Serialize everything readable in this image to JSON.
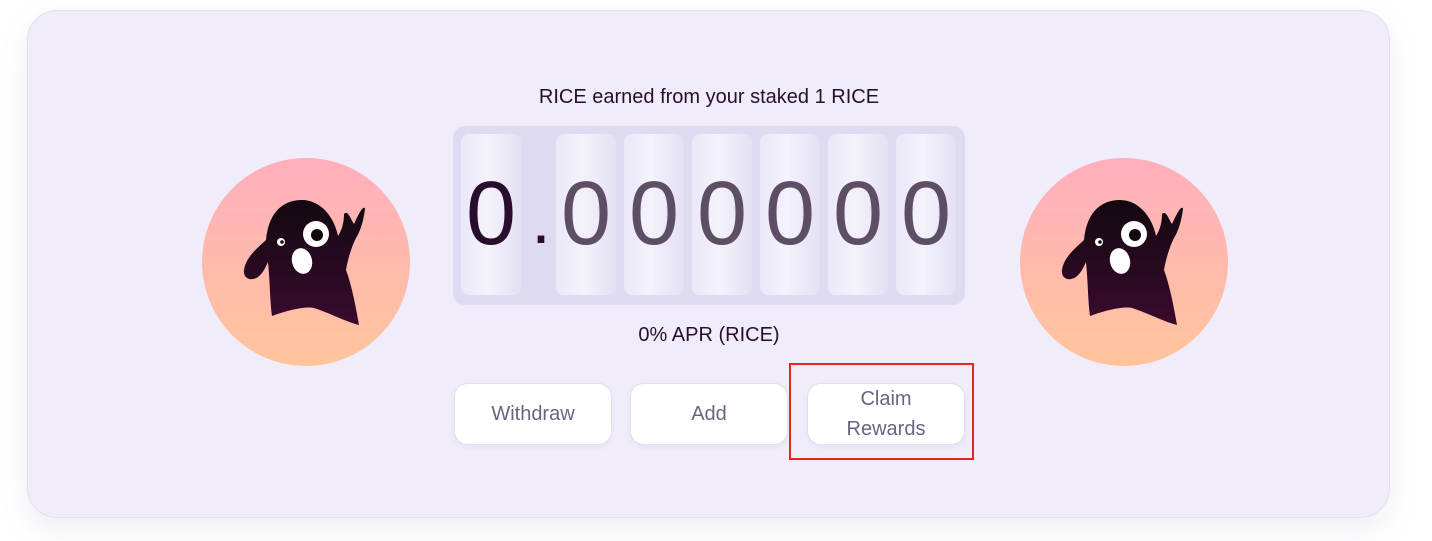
{
  "staking": {
    "earned_label": "RICE earned from your staked 1 RICE",
    "earned_value": "0.000000",
    "digits": {
      "whole": "0",
      "decimal_point": ".",
      "d1": "0",
      "d2": "0",
      "d3": "0",
      "d4": "0",
      "d5": "0",
      "d6": "0"
    },
    "apr_label": "0% APR (RICE)"
  },
  "actions": {
    "withdraw_label": "Withdraw",
    "add_label": "Add",
    "claim_label": "Claim Rewards"
  },
  "mascot": {
    "icon": "ghost-mascot-icon",
    "gradient_top": "#ffaebd",
    "gradient_bottom": "#ffc59d",
    "body_color": "#280d2f"
  },
  "highlight": {
    "target": "claim-rewards-button",
    "color": "#e5261e"
  },
  "colors": {
    "card_background": "#f0ecfa",
    "text_primary": "#280d2f",
    "button_text": "#6a6483"
  }
}
